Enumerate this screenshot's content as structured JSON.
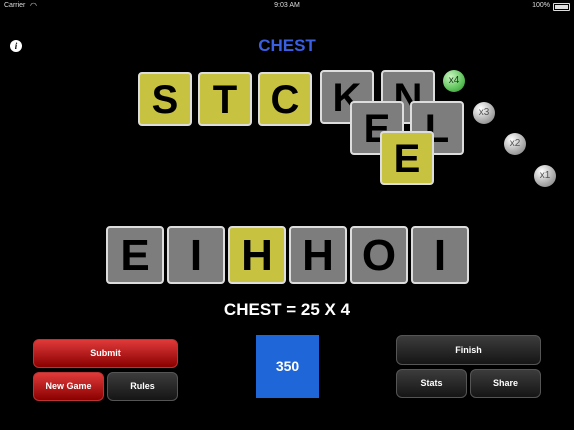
{
  "status_bar": {
    "carrier": "Carrier",
    "time": "9:03 AM",
    "battery": "100%"
  },
  "target_word": "CHEST",
  "top_tiles": [
    {
      "letter": "S",
      "color": "yellow"
    },
    {
      "letter": "T",
      "color": "yellow"
    },
    {
      "letter": "C",
      "color": "yellow"
    },
    {
      "letter": "K",
      "color": "gray"
    },
    {
      "letter": "N",
      "color": "gray"
    }
  ],
  "stack_tiles": [
    {
      "letter": "E",
      "color": "gray"
    },
    {
      "letter": "L",
      "color": "gray"
    },
    {
      "letter": "E",
      "color": "yellow"
    }
  ],
  "multipliers": [
    "x4",
    "x3",
    "x2",
    "x1"
  ],
  "active_multiplier": "x4",
  "rack_tiles": [
    {
      "letter": "E",
      "color": "gray"
    },
    {
      "letter": "I",
      "color": "gray"
    },
    {
      "letter": "H",
      "color": "yellow"
    },
    {
      "letter": "H",
      "color": "gray"
    },
    {
      "letter": "O",
      "color": "gray"
    },
    {
      "letter": "I",
      "color": "gray"
    }
  ],
  "score_text": "CHEST = 25 X 4",
  "score_value": "350",
  "buttons": {
    "submit": "Submit",
    "new_game": "New Game",
    "rules": "Rules",
    "finish": "Finish",
    "stats": "Stats",
    "share": "Share"
  },
  "colors": {
    "yellow": "#c7c240",
    "gray": "#7d7d7d",
    "title_blue": "#3a5fe0",
    "score_blue": "#1f66d8"
  }
}
